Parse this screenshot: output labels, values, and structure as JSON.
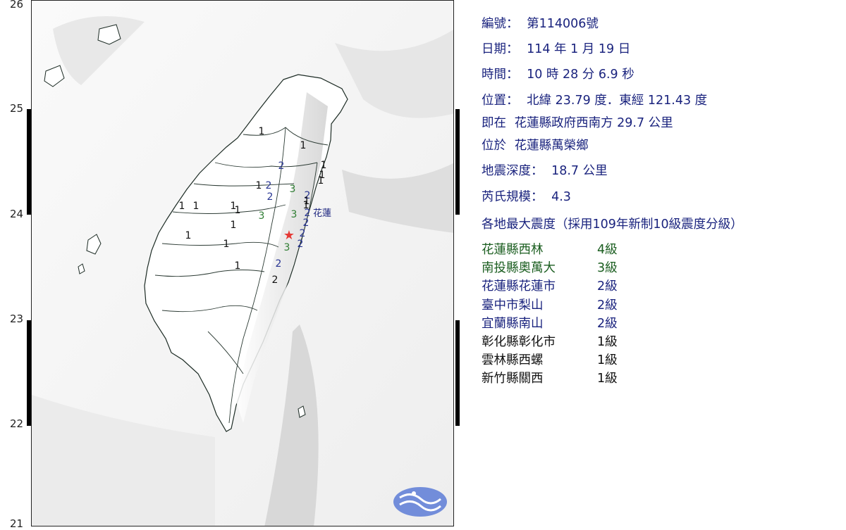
{
  "report": {
    "number_label": "編號：",
    "number_value": "第114006號",
    "date_label": "日期：",
    "date_value": "114 年 1 月 19 日",
    "time_label": "時間：",
    "time_value": "10 時 28 分 6.9 秒",
    "location_label": "位置：",
    "location_value": "北緯 23.79 度．東經 121.43 度",
    "relative_prefix": "即在",
    "relative_value": "花蓮縣政府西南方 29.7 公里",
    "township_prefix": "位於",
    "township_value": "花蓮縣萬榮鄉",
    "depth_label": "地震深度：",
    "depth_value": "18.7 公里",
    "magnitude_label": "芮氏規模：",
    "magnitude_value": "4.3",
    "intensity_heading": "各地最大震度（採用109年新制10級震度分級）"
  },
  "site_intensities": [
    {
      "name": "花蓮縣西林",
      "level": "4級",
      "color": "#1b5e20"
    },
    {
      "name": "南投縣奧萬大",
      "level": "3級",
      "color": "#1b5e20"
    },
    {
      "name": "花蓮縣花蓮市",
      "level": "2級",
      "color": "#1a237e"
    },
    {
      "name": "臺中市梨山",
      "level": "2級",
      "color": "#1a237e"
    },
    {
      "name": "宜蘭縣南山",
      "level": "2級",
      "color": "#1a237e"
    },
    {
      "name": "彰化縣彰化市",
      "level": "1級",
      "color": "#111111"
    },
    {
      "name": "雲林縣西螺",
      "level": "1級",
      "color": "#111111"
    },
    {
      "name": "新竹縣關西",
      "level": "1級",
      "color": "#111111"
    }
  ],
  "map": {
    "latitude_labels": [
      "26",
      "25",
      "24",
      "23",
      "22",
      "21"
    ],
    "place_label": "花蓮",
    "epicenter_symbol": "★",
    "station_values": [
      "1",
      "1",
      "1",
      "1",
      "1",
      "2",
      "1",
      "2",
      "3",
      "2",
      "1",
      "1",
      "1",
      "2",
      "1",
      "1",
      "2",
      "3",
      "3",
      "2",
      "1",
      "2",
      "1",
      "2",
      "3",
      "2",
      "1",
      "1",
      "2",
      "1"
    ]
  },
  "colors": {
    "level4": "#1b5e20",
    "level3": "#2e7d32",
    "level2": "#283593",
    "level1": "#111111",
    "epicenter": "#e53935",
    "text": "#1a237e",
    "logo": "#5c7bd6"
  }
}
